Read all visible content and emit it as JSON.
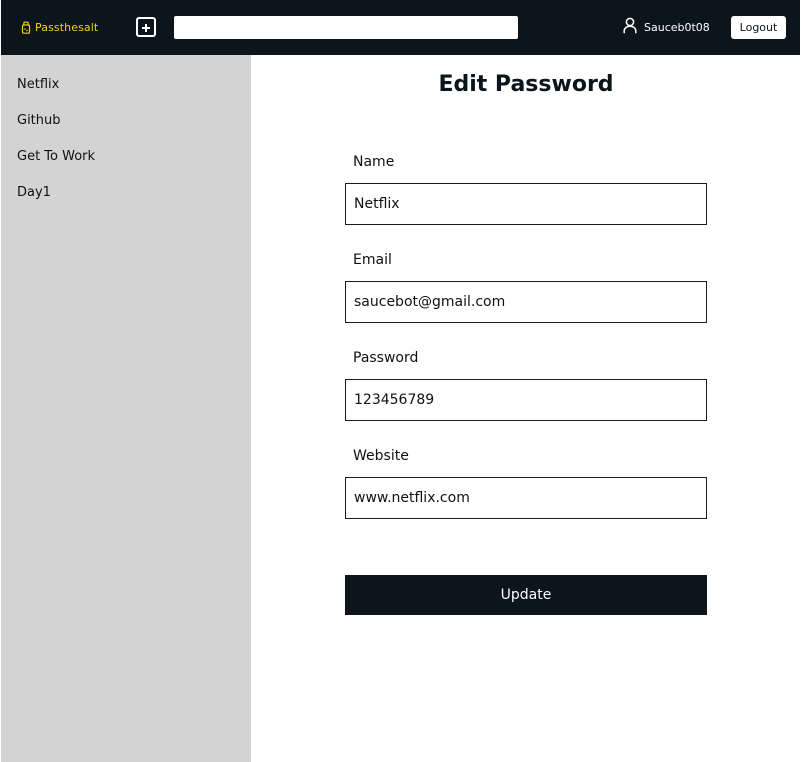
{
  "header": {
    "brand": "Passthesalt",
    "brand_icon": "salt-shaker-icon",
    "add_icon": "plus-square-icon",
    "search": {
      "value": "",
      "placeholder": ""
    },
    "username": "Sauceb0t08",
    "user_icon": "user-icon",
    "logout_label": "Logout"
  },
  "sidebar": {
    "items": [
      {
        "label": "Netflix"
      },
      {
        "label": "Github"
      },
      {
        "label": "Get To Work"
      },
      {
        "label": "Day1"
      }
    ]
  },
  "form": {
    "title": "Edit Password",
    "fields": [
      {
        "label": "Name",
        "value": "Netflix"
      },
      {
        "label": "Email",
        "value": "saucebot@gmail.com"
      },
      {
        "label": "Password",
        "value": "123456789"
      },
      {
        "label": "Website",
        "value": "www.netflix.com"
      }
    ],
    "submit_label": "Update"
  },
  "colors": {
    "header_bg": "#0b151b",
    "brand": "#f2d21b",
    "sidebar_bg": "#d3d3d3",
    "button_bg": "#0b151b"
  }
}
